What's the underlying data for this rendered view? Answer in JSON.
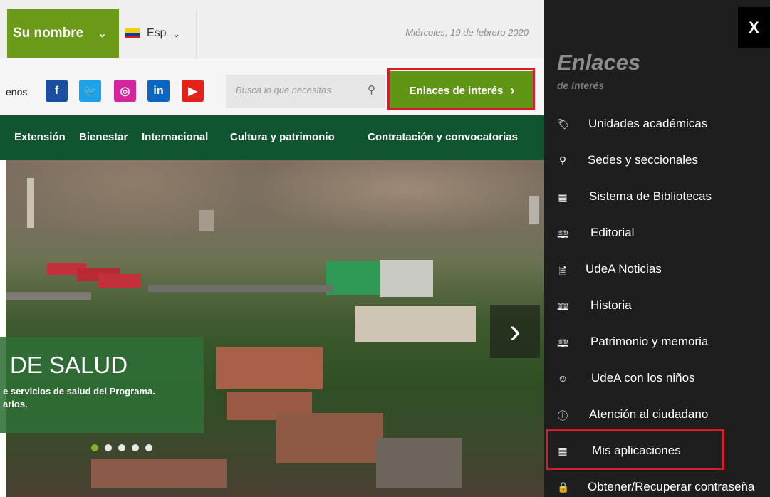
{
  "header": {
    "user_label": "Su nombre",
    "user_chevron": "⌄",
    "lang_label": "Esp",
    "lang_chevron": "⌄",
    "date": "Miércoles, 19 de febrero 2020"
  },
  "social": {
    "follow_text": "enos",
    "items": [
      {
        "name": "facebook",
        "glyph": "f",
        "color": "#1a4fa0"
      },
      {
        "name": "twitter",
        "glyph": "🐦",
        "color": "#1da1e8"
      },
      {
        "name": "instagram",
        "glyph": "◎",
        "color": "#d6249f"
      },
      {
        "name": "linkedin",
        "glyph": "in",
        "color": "#0a66c2"
      },
      {
        "name": "youtube",
        "glyph": "▶",
        "color": "#e62117"
      }
    ]
  },
  "search": {
    "placeholder": "Busca lo que necesitas",
    "icon": "search-icon"
  },
  "enlaces_button": {
    "label": "Enlaces de interés",
    "arrow": "›"
  },
  "nav": {
    "items": [
      "Extensión",
      "Bienestar",
      "Internacional",
      "Cultura y patrimonio",
      "Contratación y convocatorias"
    ]
  },
  "hero": {
    "caption_title": "DE SALUD",
    "caption_sub_1": "e servicios de salud del Programa.",
    "caption_sub_2": "arios.",
    "next_arrow": "›",
    "slide_count": 5,
    "active_slide": 1
  },
  "panel": {
    "close_label": "X",
    "title": "Enlaces",
    "subtitle": "de interés",
    "items": [
      {
        "label": "Unidades académicas",
        "icon": "tag-icon",
        "glyph": "🏷"
      },
      {
        "label": "Sedes y seccionales",
        "icon": "location-pin-icon",
        "glyph": "⚲"
      },
      {
        "label": "Sistema de Bibliotecas",
        "icon": "grid-icon",
        "glyph": "▦"
      },
      {
        "label": "Editorial",
        "icon": "book-icon",
        "glyph": "🕮"
      },
      {
        "label": "UdeA Noticias",
        "icon": "document-icon",
        "glyph": "🗎"
      },
      {
        "label": "Historia",
        "icon": "book-icon",
        "glyph": "🕮"
      },
      {
        "label": "Patrimonio y memoria",
        "icon": "book-icon",
        "glyph": "🕮"
      },
      {
        "label": "UdeA con los niños",
        "icon": "smiley-icon",
        "glyph": "☺"
      },
      {
        "label": "Atención al ciudadano",
        "icon": "info-icon",
        "glyph": "ⓘ"
      },
      {
        "label": "Mis aplicaciones",
        "icon": "grid-icon",
        "glyph": "▦"
      },
      {
        "label": "Obtener/Recuperar contraseña",
        "icon": "lock-icon",
        "glyph": "🔒"
      }
    ]
  },
  "colors": {
    "brand_green": "#6a9a17",
    "nav_green": "#0f5630",
    "highlight_red": "#d81c2a",
    "panel_bg": "#1e1e1e"
  }
}
